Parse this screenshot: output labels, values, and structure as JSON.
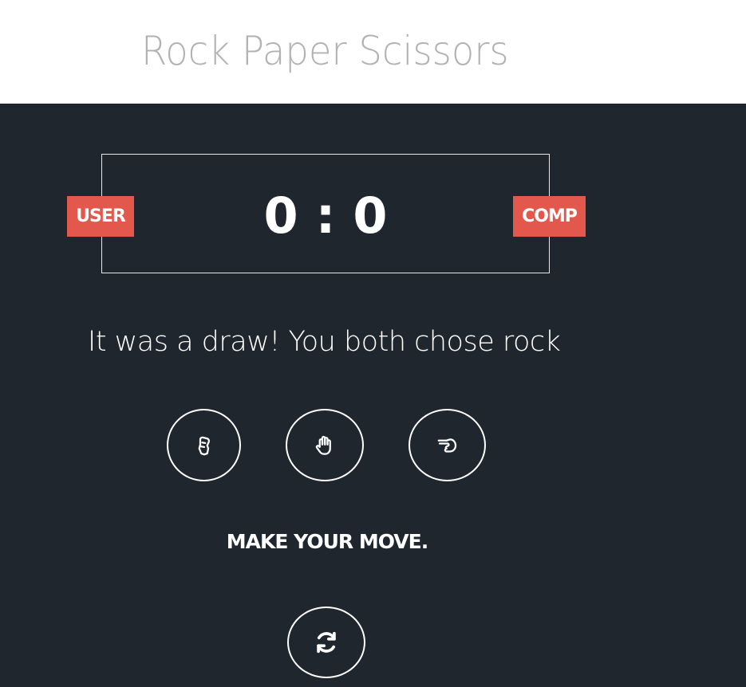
{
  "header": {
    "title": "Rock Paper Scissors"
  },
  "scoreboard": {
    "user_label": "USER",
    "comp_label": "COMP",
    "user_score": "0",
    "separator": ":",
    "comp_score": "0"
  },
  "result": {
    "message": "It was a draw! You both chose rock"
  },
  "choices": [
    {
      "name": "rock",
      "icon": "hand-rock-icon"
    },
    {
      "name": "paper",
      "icon": "hand-paper-icon"
    },
    {
      "name": "scissors",
      "icon": "hand-scissors-icon"
    }
  ],
  "prompt": {
    "text": "MAKE YOUR MOVE."
  },
  "reset": {
    "icon": "refresh-icon"
  },
  "colors": {
    "background": "#1f262e",
    "accent": "#e2584d",
    "title": "#b2b2b2"
  }
}
